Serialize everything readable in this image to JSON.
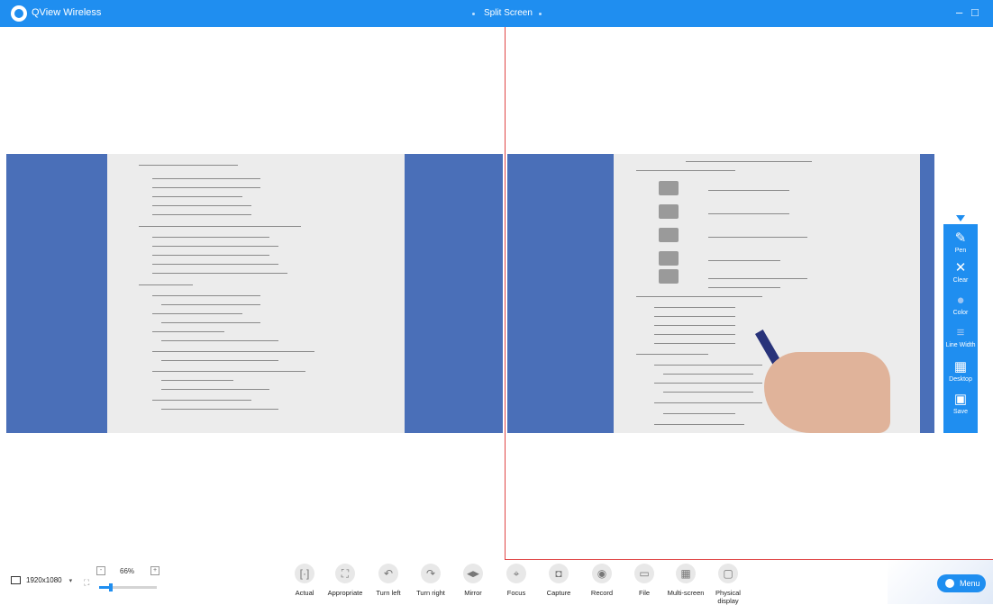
{
  "titlebar": {
    "app_name": "QView Wireless",
    "mode": "Split Screen",
    "minimize": "–",
    "maximize": "□"
  },
  "sidebar_tools": [
    {
      "label": "Pen",
      "icon": "pen-icon",
      "glyph": "✎"
    },
    {
      "label": "Clear",
      "icon": "close-icon",
      "glyph": "✕"
    },
    {
      "label": "Color",
      "icon": "palette-icon",
      "glyph": "●"
    },
    {
      "label": "Line Width",
      "icon": "line-width-icon",
      "glyph": "≡"
    },
    {
      "label": "Desktop",
      "icon": "desktop-icon",
      "glyph": "▦"
    },
    {
      "label": "Save",
      "icon": "save-icon",
      "glyph": "▣"
    }
  ],
  "status": {
    "resolution": "1920x1080",
    "zoom_level": "66%",
    "zoom_fraction": 0.2
  },
  "toolbar": [
    {
      "label": "Actual",
      "icon": "actual-size-icon",
      "glyph": "[·]"
    },
    {
      "label": "Appropriate",
      "icon": "fit-screen-icon",
      "glyph": "⛶"
    },
    {
      "label": "Turn left",
      "icon": "rotate-left-icon",
      "glyph": "↶"
    },
    {
      "label": "Turn right",
      "icon": "rotate-right-icon",
      "glyph": "↷"
    },
    {
      "label": "Mirror",
      "icon": "mirror-icon",
      "glyph": "◀▶"
    },
    {
      "label": "Focus",
      "icon": "focus-icon",
      "glyph": "⌖"
    },
    {
      "label": "Capture",
      "icon": "camera-icon",
      "glyph": "◘"
    },
    {
      "label": "Record",
      "icon": "record-icon",
      "glyph": "◉"
    },
    {
      "label": "File",
      "icon": "folder-icon",
      "glyph": "▭"
    },
    {
      "label": "Multi-screen",
      "icon": "grid-icon",
      "glyph": "▦"
    },
    {
      "label": "Physical display",
      "icon": "display-icon",
      "glyph": "▢"
    }
  ],
  "menu": {
    "label": "Menu"
  },
  "colors": {
    "accent": "#1f8ef0",
    "divider": "#e04646",
    "pane_bg": "#4a6fb8"
  }
}
